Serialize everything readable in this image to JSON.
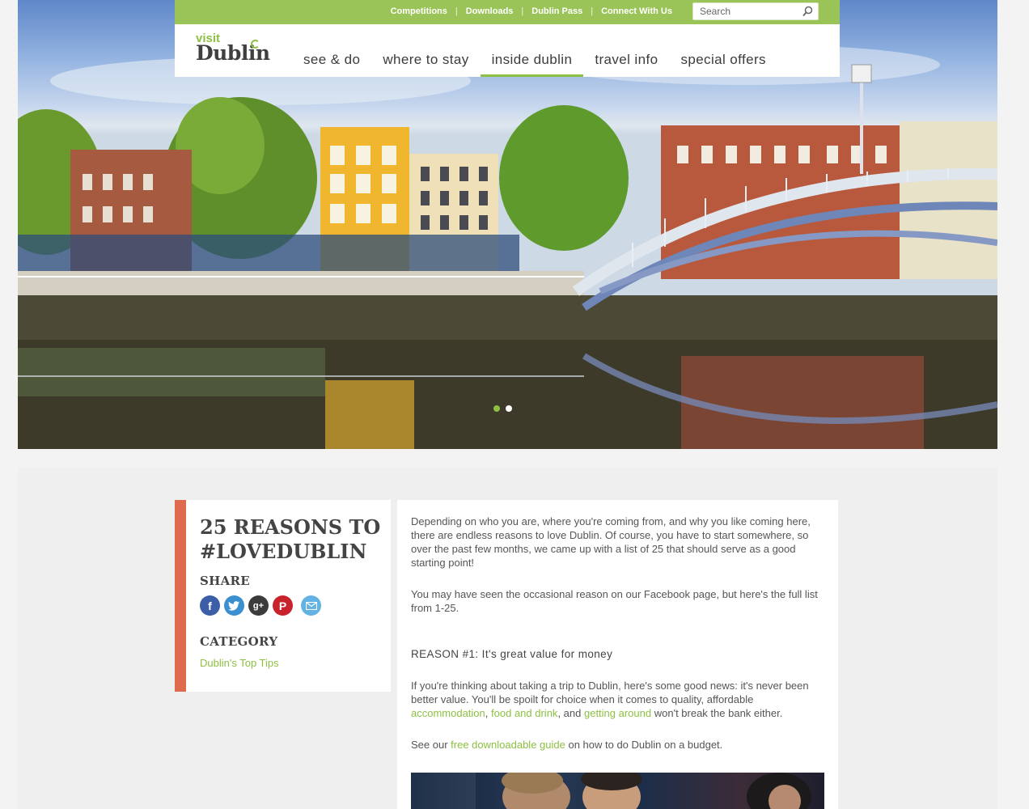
{
  "header": {
    "utility_links": [
      "Competitions",
      "Downloads",
      "Dublin Pass",
      "Connect With Us"
    ],
    "search_placeholder": "Search",
    "logo": {
      "visit": "visit",
      "dublin": "Dublin"
    },
    "nav": [
      {
        "label": "see & do",
        "active": false
      },
      {
        "label": "where to stay",
        "active": false
      },
      {
        "label": "inside dublin",
        "active": true
      },
      {
        "label": "travel info",
        "active": false
      },
      {
        "label": "special offers",
        "active": false
      }
    ],
    "brand_color": "#8dc043"
  },
  "hero": {
    "slides": 2,
    "active_slide": 1
  },
  "sidebar": {
    "title": "25 REASONS TO #LOVEDUBLIN",
    "share_label": "SHARE",
    "share_icons": [
      "facebook-icon",
      "twitter-icon",
      "google-plus-icon",
      "pinterest-icon",
      "email-icon"
    ],
    "category_label": "CATEGORY",
    "category_link": "Dublin's Top Tips",
    "accent_color": "#e06a4e"
  },
  "article": {
    "intro": "Depending on who you are, where you're coming from, and why you like coming here, there are endless reasons to love Dublin. Of course, you have to start somewhere, so over the past few months, we came up with a list of 25 that should serve as a good starting point!",
    "facebook_note": "You may have seen the occasional reason on our Facebook page, but here's the full list from 1-25.",
    "reason1_heading": "REASON #1: It's great value for money",
    "reason1_text_a": "If you're thinking about taking a trip to Dublin, here's some good news: it's never been better value. You'll be spoilt for choice when it comes to quality, affordable",
    "link_accommodation": "accommodation",
    "sep_comma": ",",
    "link_food": "food and drink",
    "text_and": ", and",
    "link_getting_around": "getting around",
    "reason1_text_b": "won't break the bank either.",
    "guide_text_a": "See our",
    "guide_link": "free downloadable guide",
    "guide_text_b": "on how to do Dublin on a budget."
  }
}
